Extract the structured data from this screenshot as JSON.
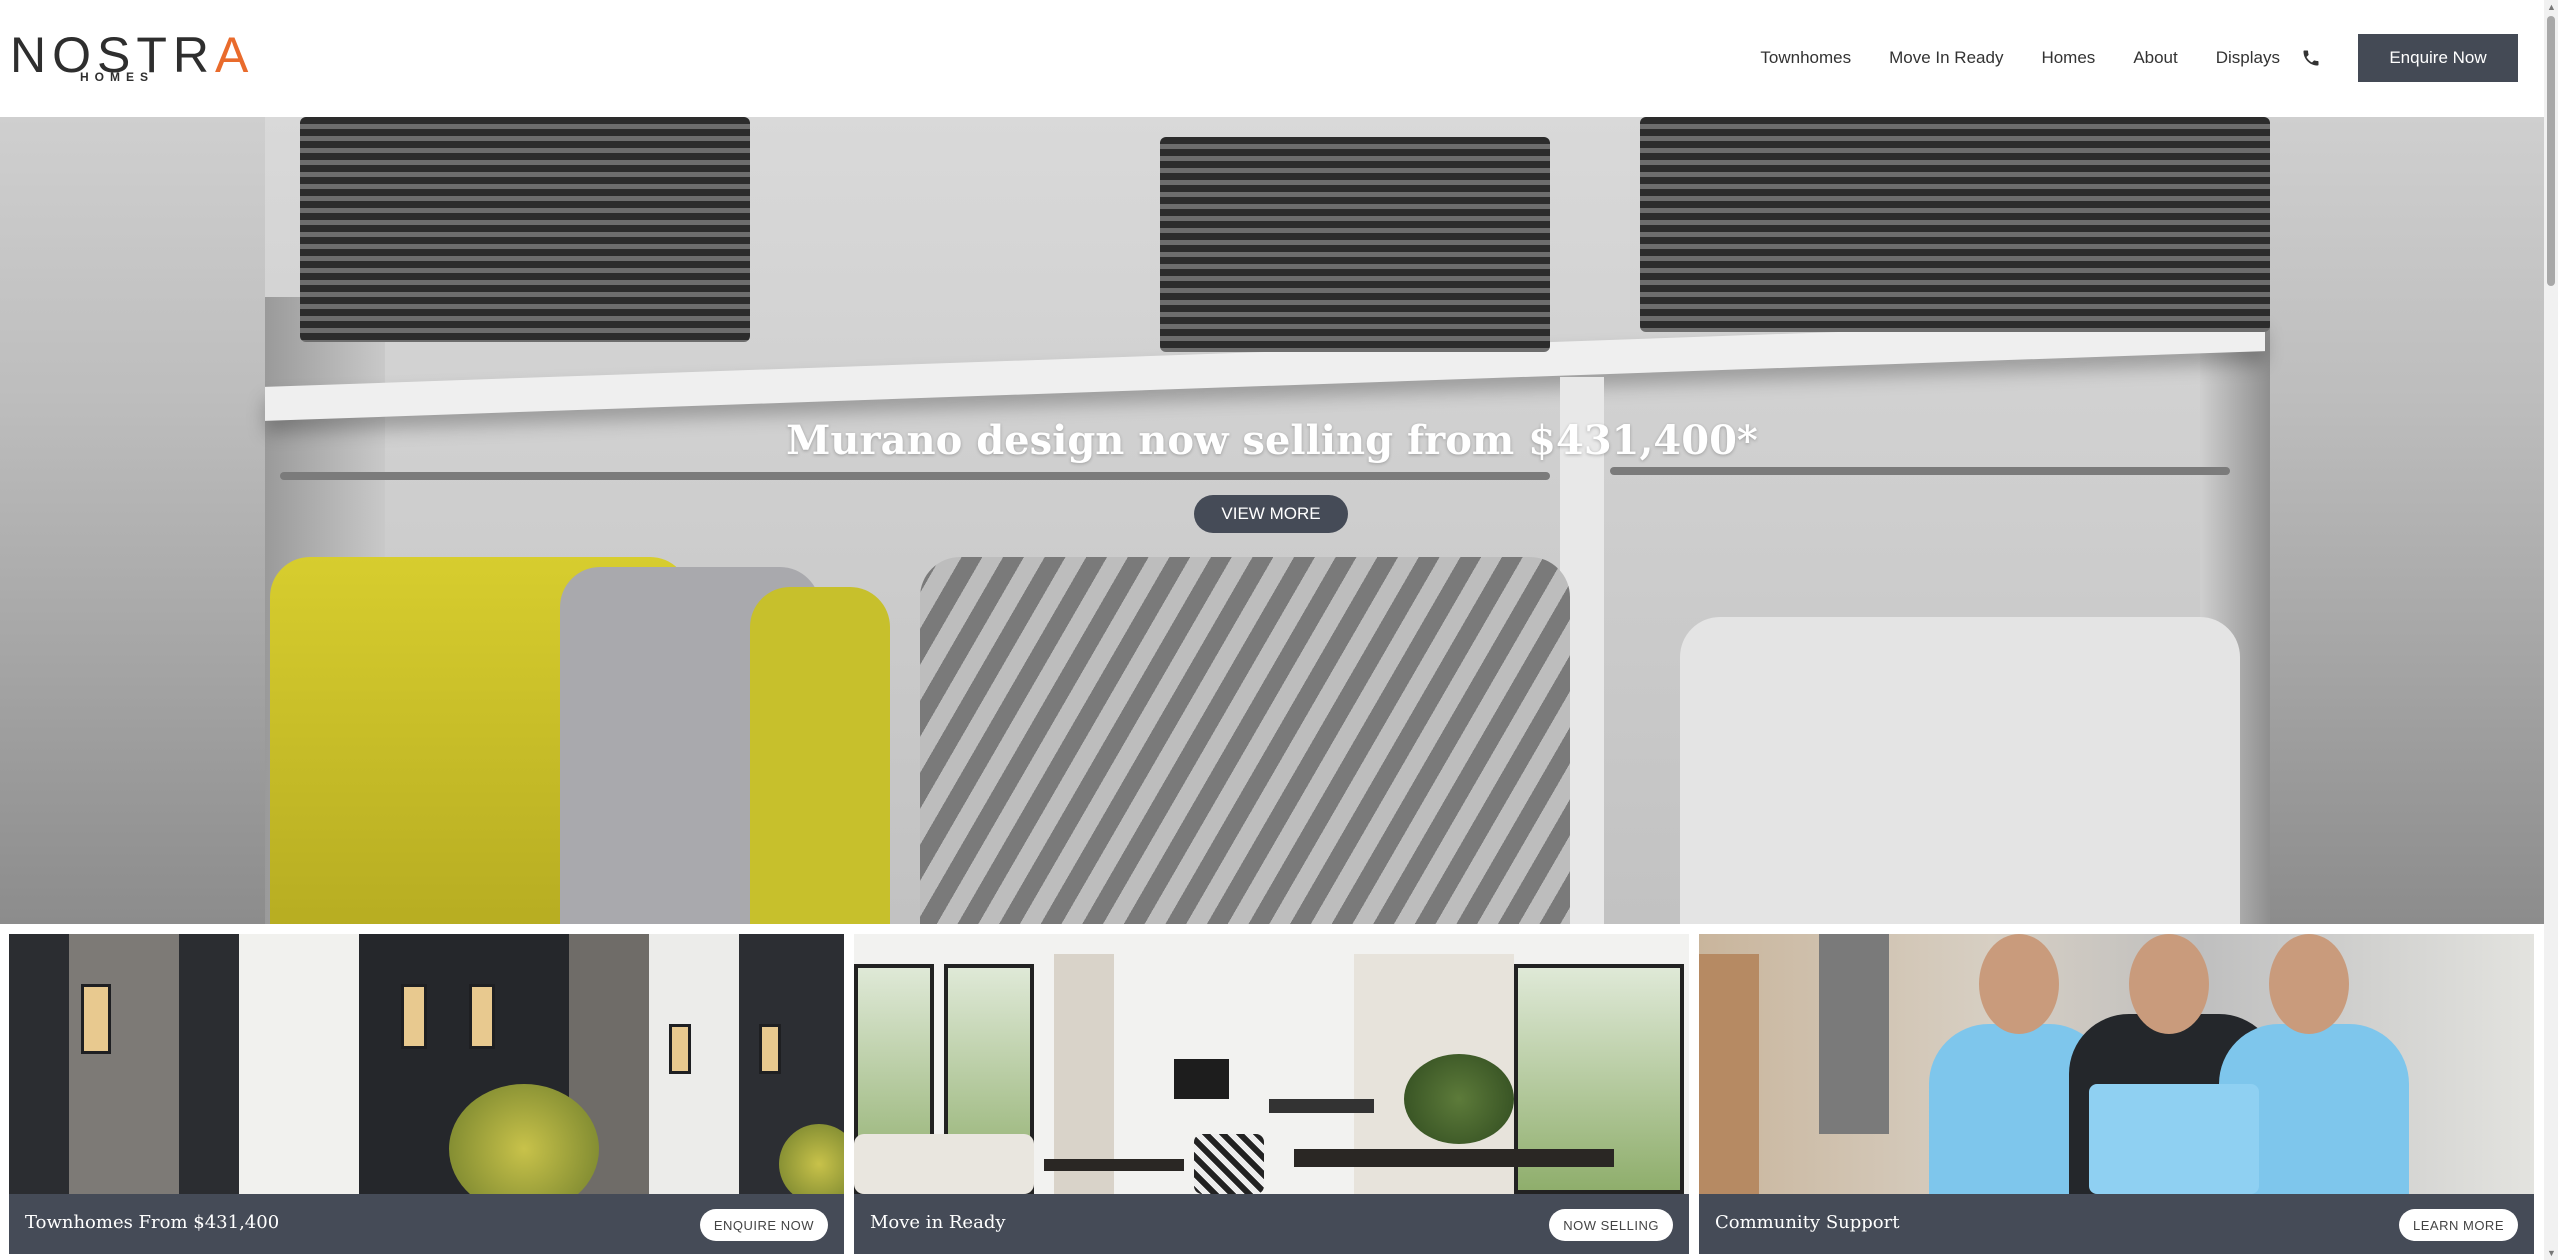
{
  "brand": {
    "logo_main_prefix": "NOSTR",
    "logo_main_accent": "A",
    "logo_sub": "HOMES",
    "accent_color": "#e96b2c",
    "dark_color": "#454b57"
  },
  "nav": {
    "items": [
      {
        "label": "Townhomes"
      },
      {
        "label": "Move In Ready"
      },
      {
        "label": "Homes"
      },
      {
        "label": "About"
      },
      {
        "label": "Displays"
      }
    ],
    "phone_icon": "phone-icon",
    "enquire_label": "Enquire Now"
  },
  "hero": {
    "title": "Murano design now selling from $431,400*",
    "button_label": "VIEW MORE"
  },
  "cards": [
    {
      "title": "Townhomes From $431,400",
      "button_label": "ENQUIRE NOW"
    },
    {
      "title": "Move in Ready",
      "button_label": "NOW SELLING"
    },
    {
      "title": "Community Support",
      "button_label": "LEARN MORE"
    }
  ]
}
